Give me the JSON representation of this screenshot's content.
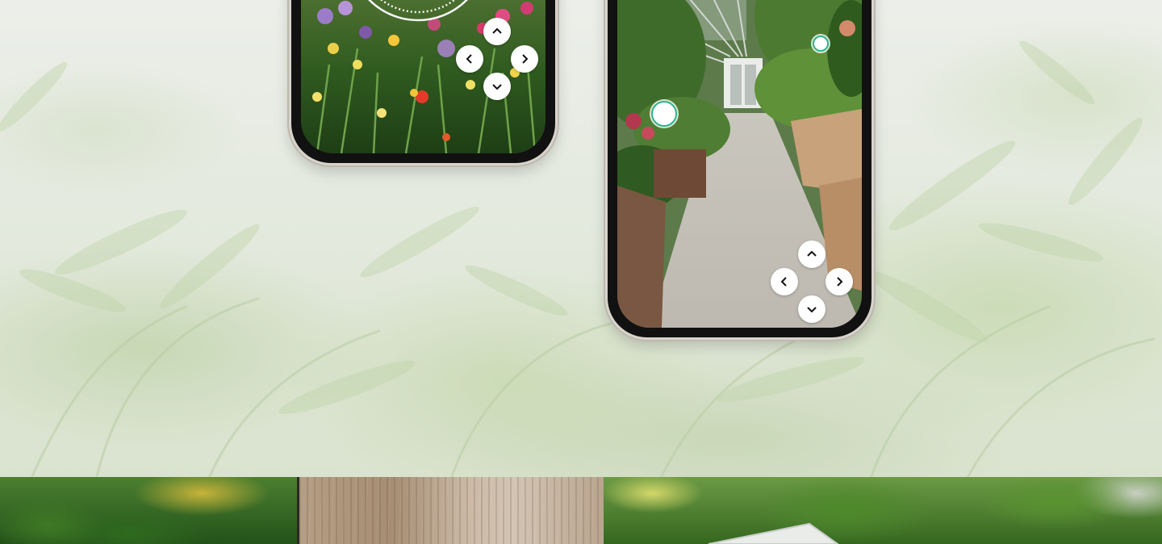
{
  "colors": {
    "hotspot_ring": "#2fb38a",
    "button_bg": "#ffffff",
    "phone_frame": "#111111"
  },
  "icons": {
    "up": "chevron-up-icon",
    "down": "chevron-down-icon",
    "left": "chevron-left-icon",
    "right": "chevron-right-icon"
  },
  "phones": [
    {
      "name": "garden-flowers-view",
      "controls": [
        "up",
        "left",
        "right",
        "down"
      ]
    },
    {
      "name": "greenhouse-walkway-view",
      "controls": [
        "up",
        "left",
        "right",
        "down"
      ],
      "hotspots": 2
    }
  ]
}
